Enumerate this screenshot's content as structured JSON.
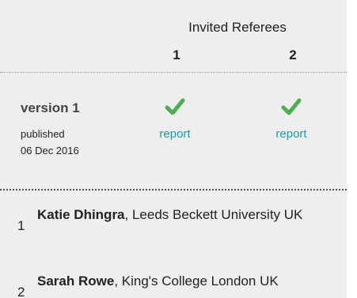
{
  "header": {
    "invited_label": "Invited Referees",
    "referee_numbers": [
      "1",
      "2"
    ]
  },
  "version": {
    "title": "version 1",
    "published_label": "published",
    "date": "06 Dec 2016",
    "reports": [
      {
        "status": "approved",
        "link_label": "report"
      },
      {
        "status": "approved",
        "link_label": "report"
      }
    ]
  },
  "referees": [
    {
      "number": "1",
      "name": "Katie Dhingra",
      "affiliation": ", Leeds Beckett University UK"
    },
    {
      "number": "2",
      "name": "Sarah Rowe",
      "affiliation": ", King's College London UK"
    }
  ],
  "colors": {
    "check": "#4caf50",
    "link": "#1a9bb0",
    "panel_bg": "#eeeeee"
  },
  "icons": {
    "approved": "checkmark-icon"
  }
}
